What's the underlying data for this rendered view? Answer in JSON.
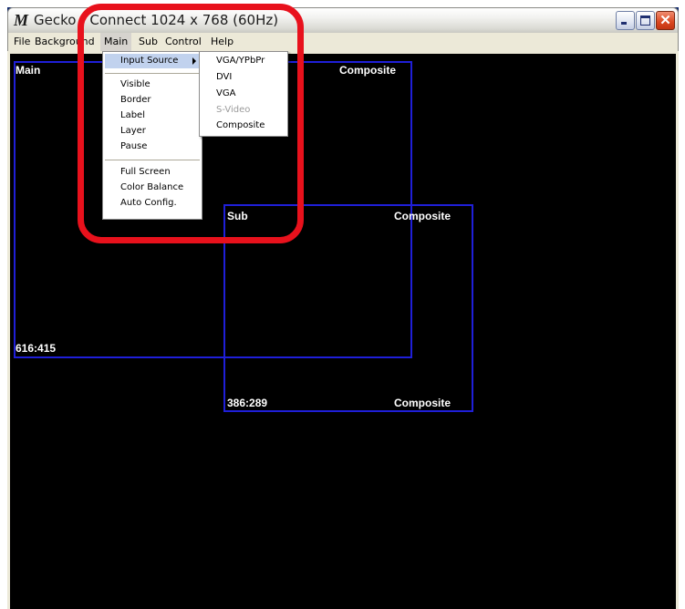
{
  "window": {
    "title": "Gecko - Connect 1024 x 768 (60Hz)",
    "app_icon": "M"
  },
  "menubar": {
    "items": [
      {
        "label": "File"
      },
      {
        "label": "Background"
      },
      {
        "label": "Main"
      },
      {
        "label": "Sub"
      },
      {
        "label": "Control"
      },
      {
        "label": "Help"
      }
    ]
  },
  "main_menu": {
    "items": [
      "Input Source",
      "Visible",
      "Border",
      "Label",
      "Layer",
      "Pause",
      "Full Screen",
      "Color Balance",
      "Auto Config."
    ]
  },
  "input_source_submenu": {
    "items": [
      "VGA/YPbPr",
      "DVI",
      "VGA",
      "S-Video",
      "Composite"
    ],
    "disabled": [
      "S-Video"
    ]
  },
  "main_pane": {
    "label": "Main",
    "source": "Composite",
    "size": "616:415"
  },
  "sub_pane": {
    "label": "Sub",
    "source_top": "Composite",
    "size": "386:289",
    "source_bottom": "Composite"
  },
  "colors": {
    "pane_border": "#1f1fd8",
    "highlight_ring": "#e8111c",
    "menu_selection": "#c1d2ee"
  }
}
